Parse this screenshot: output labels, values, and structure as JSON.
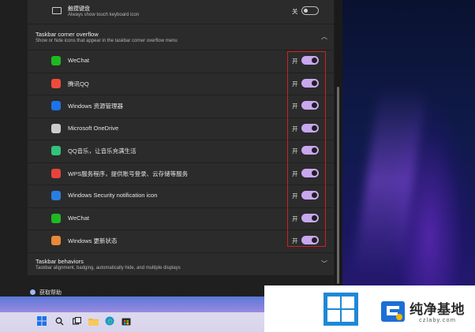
{
  "touch_keyboard": {
    "label": "触摸键盘",
    "description": "Always show touch keyboard icon",
    "state": "关",
    "enabled": false
  },
  "overflow_section": {
    "title": "Taskbar corner overflow",
    "subtitle": "Show or hide icons that appear in the taskbar corner overflow menu",
    "icon": "chevron-up-icon"
  },
  "overflow_items": [
    {
      "name": "WeChat",
      "state": "开",
      "enabled": true,
      "icon": "wechat-icon",
      "color": "#1fb922"
    },
    {
      "name": "腾讯QQ",
      "state": "开",
      "enabled": true,
      "icon": "qq-icon",
      "color": "#f04a3c"
    },
    {
      "name": "Windows 资源管理器",
      "state": "开",
      "enabled": true,
      "icon": "bluetooth-icon",
      "color": "#1e73e8"
    },
    {
      "name": "Microsoft OneDrive",
      "state": "开",
      "enabled": true,
      "icon": "onedrive-icon",
      "color": "#cccccc"
    },
    {
      "name": "QQ音乐，让音乐充满生活",
      "state": "开",
      "enabled": true,
      "icon": "qq-music-icon",
      "color": "#31c27c"
    },
    {
      "name": "WPS服务程序，提供账号登录、云存储等服务",
      "state": "开",
      "enabled": true,
      "icon": "wps-icon",
      "color": "#e8433a"
    },
    {
      "name": "Windows Security notification icon",
      "state": "开",
      "enabled": true,
      "icon": "windows-security-icon",
      "color": "#2a7de1"
    },
    {
      "name": "WeChat",
      "state": "开",
      "enabled": true,
      "icon": "wechat-icon",
      "color": "#1fb922"
    },
    {
      "name": "Windows 更新状态",
      "state": "开",
      "enabled": true,
      "icon": "windows-update-icon",
      "color": "#e8883a"
    }
  ],
  "behaviors_section": {
    "title": "Taskbar behaviors",
    "subtitle": "Taskbar alignment, badging, automatically hide, and multiple displays",
    "icon": "chevron-down-icon"
  },
  "help": {
    "label": "获取帮助"
  },
  "taskbar_icons": [
    "start-icon",
    "search-icon",
    "task-view-icon",
    "file-explorer-icon",
    "edge-icon",
    "store-icon"
  ],
  "watermark": {
    "title": "纯净基地",
    "url": "czlaby.com"
  },
  "colors": {
    "toggle_on": "#c9a7f0",
    "highlight_box": "#d02020",
    "card": "#2b2b2b",
    "background": "#1f1f1f"
  }
}
